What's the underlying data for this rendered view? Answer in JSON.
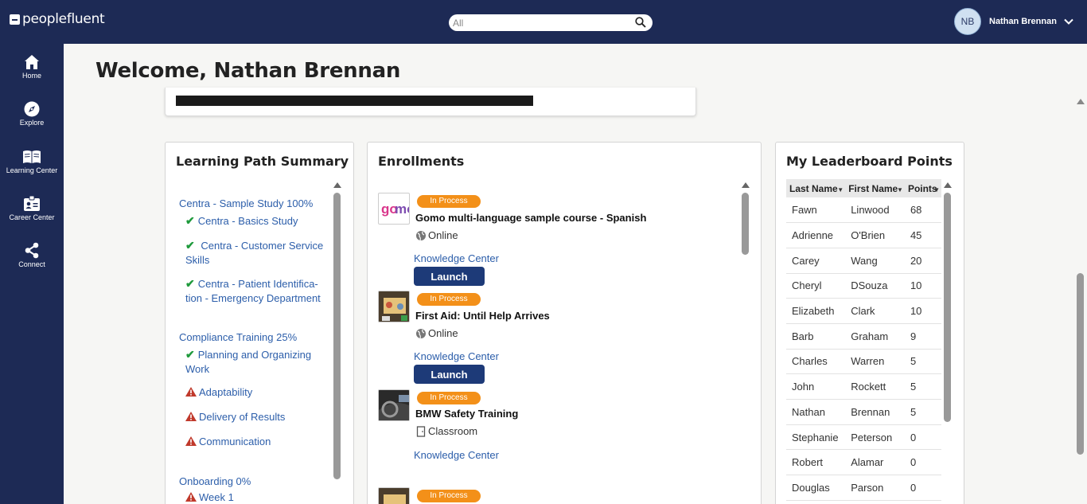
{
  "header": {
    "logo_text": "peoplefluent",
    "search_placeholder": "All",
    "user_initials": "NB",
    "user_name": "Nathan Brennan"
  },
  "sidebar": {
    "items": [
      {
        "label": "Home",
        "icon": "home-icon"
      },
      {
        "label": "Explore",
        "icon": "compass-icon"
      },
      {
        "label": "Learning Center",
        "icon": "book-icon"
      },
      {
        "label": "Career Center",
        "icon": "badge-icon"
      },
      {
        "label": "Connect",
        "icon": "share-icon"
      }
    ]
  },
  "welcome": "Welcome, Nathan Brennan",
  "learning_path": {
    "title": "Learning Path Summary",
    "groups": [
      {
        "label": "Centra - Sample Study 100%",
        "items": [
          {
            "label": "Centra - Basics Study",
            "status": "complete"
          },
          {
            "label": "Centra - Customer Service Skills",
            "status": "complete"
          },
          {
            "label": "Centra - Patient Identifica-tion - Emergency Department",
            "status": "complete"
          }
        ]
      },
      {
        "label": "Compliance Training 25%",
        "items": [
          {
            "label": "Planning and Organizing Work",
            "status": "complete"
          },
          {
            "label": "Adaptability",
            "status": "warning"
          },
          {
            "label": "Delivery of Results",
            "status": "warning"
          },
          {
            "label": "Communication",
            "status": "warning"
          }
        ]
      },
      {
        "label": "Onboarding 0%",
        "items": [
          {
            "label": "Week 1",
            "status": "warning"
          }
        ]
      }
    ]
  },
  "enrollments": {
    "title": "Enrollments",
    "items": [
      {
        "status": "In Process",
        "title": "Gomo multi-language sample course - Spanish",
        "mode": "Online",
        "link": "Knowledge Center",
        "button": "Launch"
      },
      {
        "status": "In Process",
        "title": "First Aid: Until Help Arrives",
        "mode": "Online",
        "link": "Knowledge Center",
        "button": "Launch"
      },
      {
        "status": "In Process",
        "title": "BMW Safety Training",
        "mode": "Classroom",
        "link": "Knowledge Center"
      },
      {
        "status": "In Process"
      }
    ]
  },
  "leaderboard": {
    "title": "My Leaderboard Points",
    "columns": [
      "Last Name",
      "First Name",
      "Points"
    ],
    "rows": [
      [
        "Fawn",
        "Linwood",
        "68"
      ],
      [
        "Adrienne",
        "O'Brien",
        "45"
      ],
      [
        "Carey",
        "Wang",
        "20"
      ],
      [
        "Cheryl",
        "DSouza",
        "10"
      ],
      [
        "Elizabeth",
        "Clark",
        "10"
      ],
      [
        "Barb",
        "Graham",
        "9"
      ],
      [
        "Charles",
        "Warren",
        "5"
      ],
      [
        "John",
        "Rockett",
        "5"
      ],
      [
        "Nathan",
        "Brennan",
        "5"
      ],
      [
        "Stephanie",
        "Peterson",
        "0"
      ],
      [
        "Robert",
        "Alamar",
        "0"
      ],
      [
        "Douglas",
        "Parson",
        "0"
      ]
    ]
  },
  "colors": {
    "nav_bg": "#1d2a55",
    "badge": "#f39019",
    "button": "#1d3a78",
    "link": "#2c5eaa",
    "check": "#1f9a3c",
    "warning": "#c0392b"
  }
}
